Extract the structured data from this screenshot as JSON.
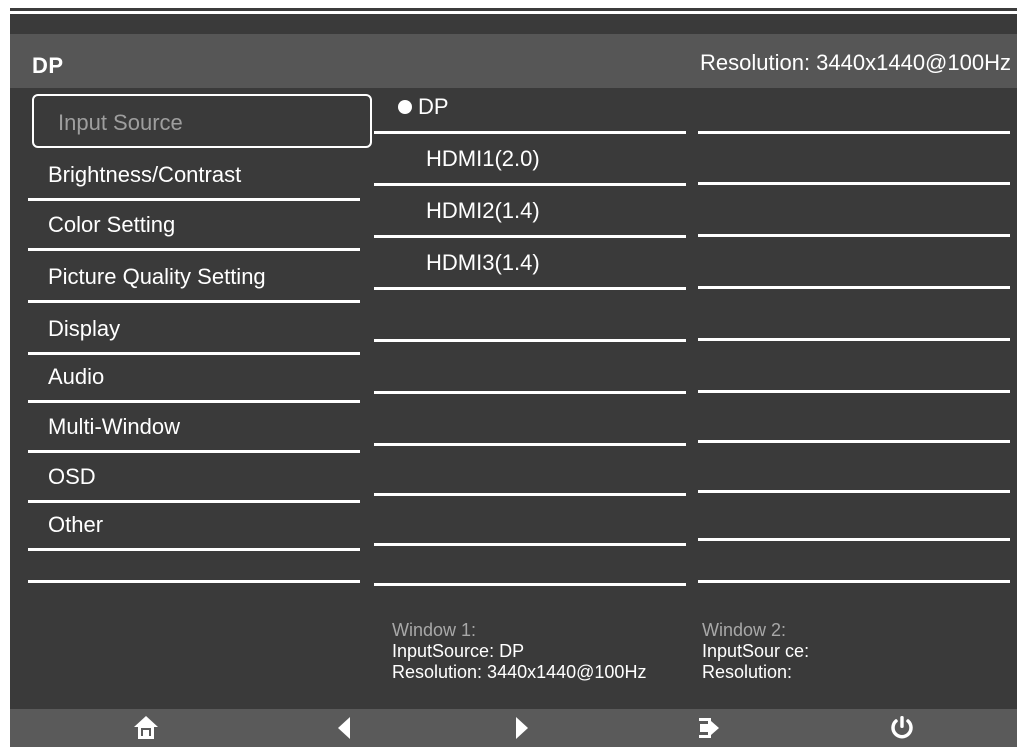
{
  "header": {
    "source": "DP",
    "resolution": "Resolution: 3440x1440@100Hz"
  },
  "menu": {
    "items": [
      {
        "label": "Input Source",
        "selected": true
      },
      {
        "label": "Brightness/Contrast"
      },
      {
        "label": "Color Setting"
      },
      {
        "label": "Picture Quality Setting"
      },
      {
        "label": "Display"
      },
      {
        "label": "Audio"
      },
      {
        "label": "Multi-Window"
      },
      {
        "label": "OSD"
      },
      {
        "label": "Other"
      }
    ]
  },
  "input_options": [
    {
      "label": "DP",
      "selected": true
    },
    {
      "label": "HDMI1(2.0)"
    },
    {
      "label": "HDMI2(1.4)"
    },
    {
      "label": "HDMI3(1.4)"
    }
  ],
  "window1": {
    "title": "Window 1:",
    "input": "InputSource: DP",
    "resolution": "Resolution: 3440x1440@100Hz"
  },
  "window2": {
    "title": "Window 2:",
    "input": "InputSour ce:",
    "resolution": "Resolution:"
  },
  "bottom_bar": {
    "buttons": [
      {
        "icon": "home-icon"
      },
      {
        "icon": "left-arrow-icon"
      },
      {
        "icon": "right-arrow-icon"
      },
      {
        "icon": "enter-icon"
      },
      {
        "icon": "power-icon"
      }
    ]
  }
}
